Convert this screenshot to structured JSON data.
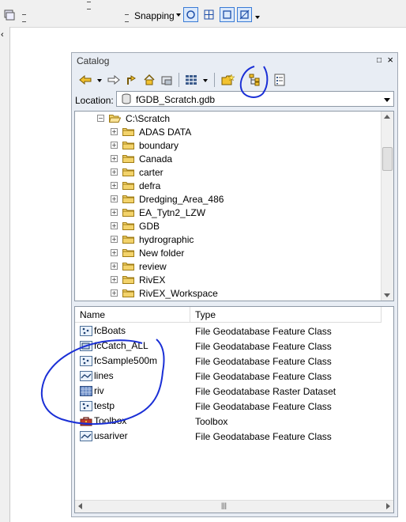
{
  "toolbar_top": {
    "snapping_label": "Snapping"
  },
  "catalog": {
    "title": "Catalog",
    "location_label": "Location:",
    "location_value": "fGDB_Scratch.gdb",
    "tree": {
      "root": "C:\\Scratch",
      "children": [
        "ADAS DATA",
        "boundary",
        "Canada",
        "carter",
        "defra",
        "Dredging_Area_486",
        "EA_Tytn2_LZW",
        "GDB",
        "hydrographic",
        "New folder",
        "review",
        "RivEX",
        "RivEX_Workspace"
      ]
    },
    "contents": {
      "columns": [
        "Name",
        "Type"
      ],
      "rows": [
        {
          "name": "fcBoats",
          "type": "File Geodatabase Feature Class",
          "icon": "point-feature-class-icon"
        },
        {
          "name": "fcCatch_ALL",
          "type": "File Geodatabase Feature Class",
          "icon": "polygon-feature-class-icon"
        },
        {
          "name": "fcSample500m",
          "type": "File Geodatabase Feature Class",
          "icon": "point-feature-class-icon"
        },
        {
          "name": "lines",
          "type": "File Geodatabase Feature Class",
          "icon": "line-feature-class-icon"
        },
        {
          "name": "riv",
          "type": "File Geodatabase Raster Dataset",
          "icon": "raster-dataset-icon"
        },
        {
          "name": "testp",
          "type": "File Geodatabase Feature Class",
          "icon": "point-feature-class-icon"
        },
        {
          "name": "Toolbox",
          "type": "Toolbox",
          "icon": "toolbox-icon"
        },
        {
          "name": "usariver",
          "type": "File Geodatabase Feature Class",
          "icon": "line-feature-class-icon"
        }
      ]
    }
  },
  "colors": {
    "annotation": "#1a2fd6",
    "folder": "#f3d36b",
    "window_bg": "#e8edf4"
  }
}
